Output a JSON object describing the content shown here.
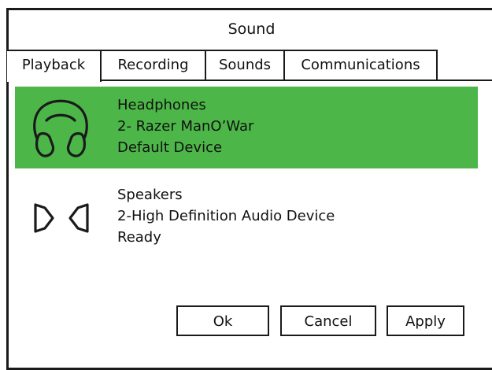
{
  "window": {
    "title": "Sound"
  },
  "tabs": [
    {
      "label": "Playback",
      "active": true
    },
    {
      "label": "Recording",
      "active": false
    },
    {
      "label": "Sounds",
      "active": false
    },
    {
      "label": "Communications",
      "active": false
    }
  ],
  "devices": [
    {
      "icon": "headphones-icon",
      "name": "Headphones",
      "description": "2- Razer ManO’War",
      "status": "Default Device",
      "selected": true
    },
    {
      "icon": "speakers-icon",
      "name": "Speakers",
      "description": "2-High Definition Audio Device",
      "status": "Ready",
      "selected": false
    }
  ],
  "buttons": {
    "ok": "Ok",
    "cancel": "Cancel",
    "apply": "Apply"
  },
  "colors": {
    "selected_background": "#4cb748",
    "border": "#1a1a1a"
  }
}
